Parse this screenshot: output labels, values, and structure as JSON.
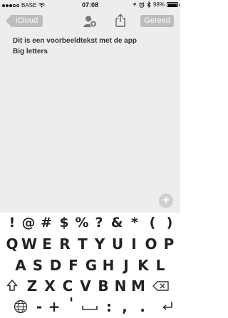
{
  "status_bar": {
    "carrier": "BASE",
    "time": "07:08",
    "battery_percent": "98%",
    "battery_level": 0.98,
    "signal_bars": 3,
    "signal_total": 5
  },
  "nav": {
    "back_label": "iCloud",
    "done_label": "Gereed"
  },
  "note": {
    "lines": [
      "Dit is een voorbeeldtekst met de app",
      "Big letters"
    ],
    "add_label": "+"
  },
  "keyboard": {
    "row1": [
      "!",
      "@",
      "#",
      "$",
      "%",
      "?",
      "&",
      "*",
      "(",
      ")"
    ],
    "row2": [
      "Q",
      "W",
      "E",
      "R",
      "T",
      "Y",
      "U",
      "I",
      "O",
      "P"
    ],
    "row3": [
      "A",
      "S",
      "D",
      "F",
      "G",
      "H",
      "J",
      "K",
      "L"
    ],
    "row4": [
      "Z",
      "X",
      "C",
      "V",
      "B",
      "N",
      "M"
    ],
    "row5": [
      "-",
      "+",
      "'",
      ":",
      ",",
      "."
    ]
  },
  "colors": {
    "background": "#ededed",
    "keyboard_background": "#ffffff",
    "button_fill": "#bdbdbd"
  }
}
